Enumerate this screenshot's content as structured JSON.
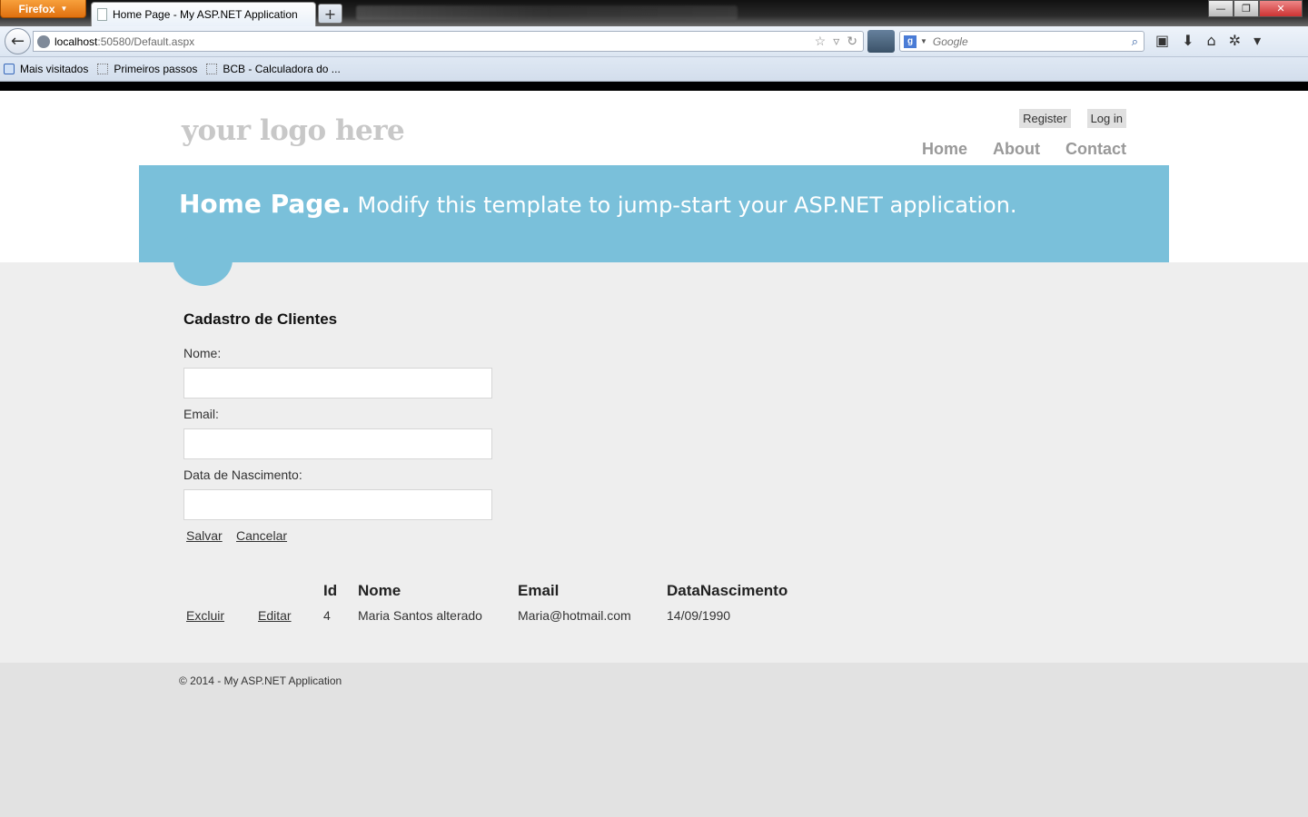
{
  "browser": {
    "menu_label": "Firefox",
    "tab_title": "Home Page - My ASP.NET Application",
    "new_tab_label": "+",
    "url_host": "localhost",
    "url_rest": ":50580/Default.aspx",
    "search_placeholder": "Google",
    "bookmarks": [
      "Mais visitados",
      "Primeiros passos",
      "BCB - Calculadora do ..."
    ],
    "window_controls": [
      "—",
      "❐",
      "✕"
    ]
  },
  "site": {
    "logo": "your logo here",
    "login_links": [
      "Register",
      "Log in"
    ],
    "menu": [
      "Home",
      "About",
      "Contact"
    ],
    "featured_strong": "Home Page.",
    "featured_text": " Modify this template to jump-start your ASP.NET application."
  },
  "form": {
    "title": "Cadastro de Clientes",
    "nome_label": "Nome:",
    "email_label": "Email:",
    "nascimento_label": "Data de Nascimento:",
    "nome_value": "",
    "email_value": "",
    "nascimento_value": "",
    "save_label": "Salvar",
    "cancel_label": "Cancelar"
  },
  "grid": {
    "headers": [
      "Id",
      "Nome",
      "Email",
      "DataNascimento"
    ],
    "rows": [
      {
        "delete_label": "Excluir",
        "edit_label": "Editar",
        "id": "4",
        "nome": "Maria Santos alterado",
        "email": "Maria@hotmail.com",
        "nascimento": "14/09/1990"
      }
    ]
  },
  "footer": {
    "text": "© 2014 - My ASP.NET Application"
  },
  "colors": {
    "featured_bg": "#7ac0da",
    "main_bg": "#eeeeee",
    "footer_bg": "#e2e2e2"
  }
}
